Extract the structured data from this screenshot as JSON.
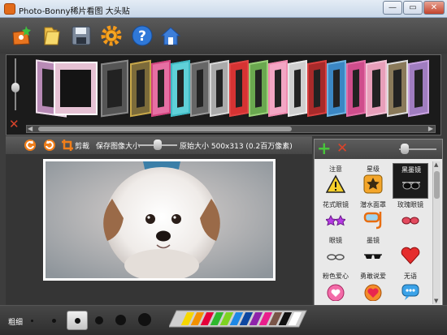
{
  "window": {
    "title": "Photo-Bonny稀片看图 大头贴",
    "minimize": "—",
    "restore": "▭",
    "close": "✕"
  },
  "toolbar": {
    "items": [
      "open-photo-icon",
      "folder-icon",
      "save-icon",
      "settings-gear-icon",
      "help-icon",
      "home-icon"
    ]
  },
  "editbar": {
    "crop_label": "剪裁",
    "save_size_label": "保存图像大小",
    "original_size_label": "原始大小 500x313 (0.2百万像素)",
    "save_size_level": 0.5
  },
  "brushbar": {
    "label": "粗细",
    "selected_index": 2
  },
  "panel": {
    "items": [
      {
        "label": "注意",
        "icon": "warning-icon",
        "selected": false
      },
      {
        "label": "星级",
        "icon": "star-badge-icon",
        "selected": false
      },
      {
        "label": "黑墨镜",
        "icon": "black-sunglasses-icon",
        "selected": true
      },
      {
        "label": "花式眼镜",
        "icon": "fancy-glasses-icon",
        "selected": false
      },
      {
        "label": "潜水面罩",
        "icon": "diving-mask-icon",
        "selected": false
      },
      {
        "label": "玫瑰眼镜",
        "icon": "rose-glasses-icon",
        "selected": false
      },
      {
        "label": "眼镜",
        "icon": "glasses-icon",
        "selected": false
      },
      {
        "label": "墨镜",
        "icon": "sunglasses-icon",
        "selected": false
      },
      {
        "label": "",
        "icon": "red-heart-icon",
        "selected": false
      },
      {
        "label": "粉色爱心",
        "icon": "pink-heart-icon",
        "selected": false
      },
      {
        "label": "勇敢说爱",
        "icon": "love-heart-icon",
        "selected": false
      },
      {
        "label": "无语",
        "icon": "speech-bubble-icon",
        "selected": false
      }
    ]
  },
  "colors": {
    "accent_add": "#48c43b",
    "accent_delete": "#d9442b"
  }
}
